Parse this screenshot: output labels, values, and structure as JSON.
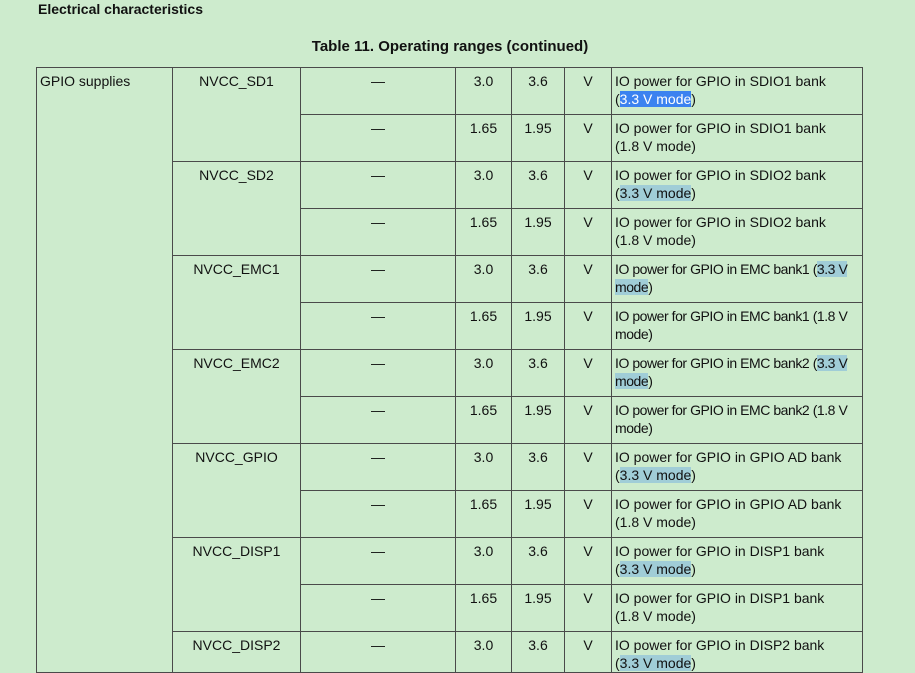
{
  "header": {
    "section_title": "Electrical characteristics"
  },
  "table": {
    "caption": "Table 11. Operating ranges (continued)",
    "group_label": "GPIO supplies",
    "rows": [
      {
        "symbol": "NVCC_SD1",
        "condition": "—",
        "min": "3.0",
        "max": "3.6",
        "unit": "V",
        "desc": "IO power for GPIO in SDIO1 bank",
        "mode": "3.3 V mode"
      },
      {
        "symbol": "",
        "condition": "—",
        "min": "1.65",
        "max": "1.95",
        "unit": "V",
        "desc": "IO power for GPIO in SDIO1 bank",
        "mode": "1.8 V mode"
      },
      {
        "symbol": "NVCC_SD2",
        "condition": "—",
        "min": "3.0",
        "max": "3.6",
        "unit": "V",
        "desc": "IO power for GPIO in SDIO2 bank",
        "mode": "3.3 V mode"
      },
      {
        "symbol": "",
        "condition": "—",
        "min": "1.65",
        "max": "1.95",
        "unit": "V",
        "desc": "IO power for GPIO in SDIO2 bank",
        "mode": "1.8 V mode"
      },
      {
        "symbol": "NVCC_EMC1",
        "condition": "—",
        "min": "3.0",
        "max": "3.6",
        "unit": "V",
        "desc": "IO power for GPIO in EMC bank1",
        "mode": "3.3 V mode"
      },
      {
        "symbol": "",
        "condition": "—",
        "min": "1.65",
        "max": "1.95",
        "unit": "V",
        "desc": "IO power for GPIO in EMC bank1",
        "mode": "1.8 V mode"
      },
      {
        "symbol": "NVCC_EMC2",
        "condition": "—",
        "min": "3.0",
        "max": "3.6",
        "unit": "V",
        "desc": "IO power for GPIO in EMC bank2",
        "mode": "3.3 V mode"
      },
      {
        "symbol": "",
        "condition": "—",
        "min": "1.65",
        "max": "1.95",
        "unit": "V",
        "desc": "IO power for GPIO in EMC bank2",
        "mode": "1.8 V mode"
      },
      {
        "symbol": "NVCC_GPIO",
        "condition": "—",
        "min": "3.0",
        "max": "3.6",
        "unit": "V",
        "desc": "IO power for GPIO in GPIO AD bank",
        "mode": "3.3 V mode"
      },
      {
        "symbol": "",
        "condition": "—",
        "min": "1.65",
        "max": "1.95",
        "unit": "V",
        "desc": "IO power for GPIO in GPIO AD bank",
        "mode": "1.8 V mode"
      },
      {
        "symbol": "NVCC_DISP1",
        "condition": "—",
        "min": "3.0",
        "max": "3.6",
        "unit": "V",
        "desc": "IO power for GPIO in DISP1 bank",
        "mode": "3.3 V mode"
      },
      {
        "symbol": "",
        "condition": "—",
        "min": "1.65",
        "max": "1.95",
        "unit": "V",
        "desc": "IO power for GPIO in DISP1 bank",
        "mode": "1.8 V mode"
      },
      {
        "symbol": "NVCC_DISP2",
        "condition": "—",
        "min": "3.0",
        "max": "3.6",
        "unit": "V",
        "desc": "IO power for GPIO in DISP2 bank",
        "mode": "3.3 V mode"
      }
    ]
  },
  "colors": {
    "page_background": "#cdebcd",
    "search_highlight": "#a0cdd7",
    "selection_highlight": "#3b82f0"
  }
}
